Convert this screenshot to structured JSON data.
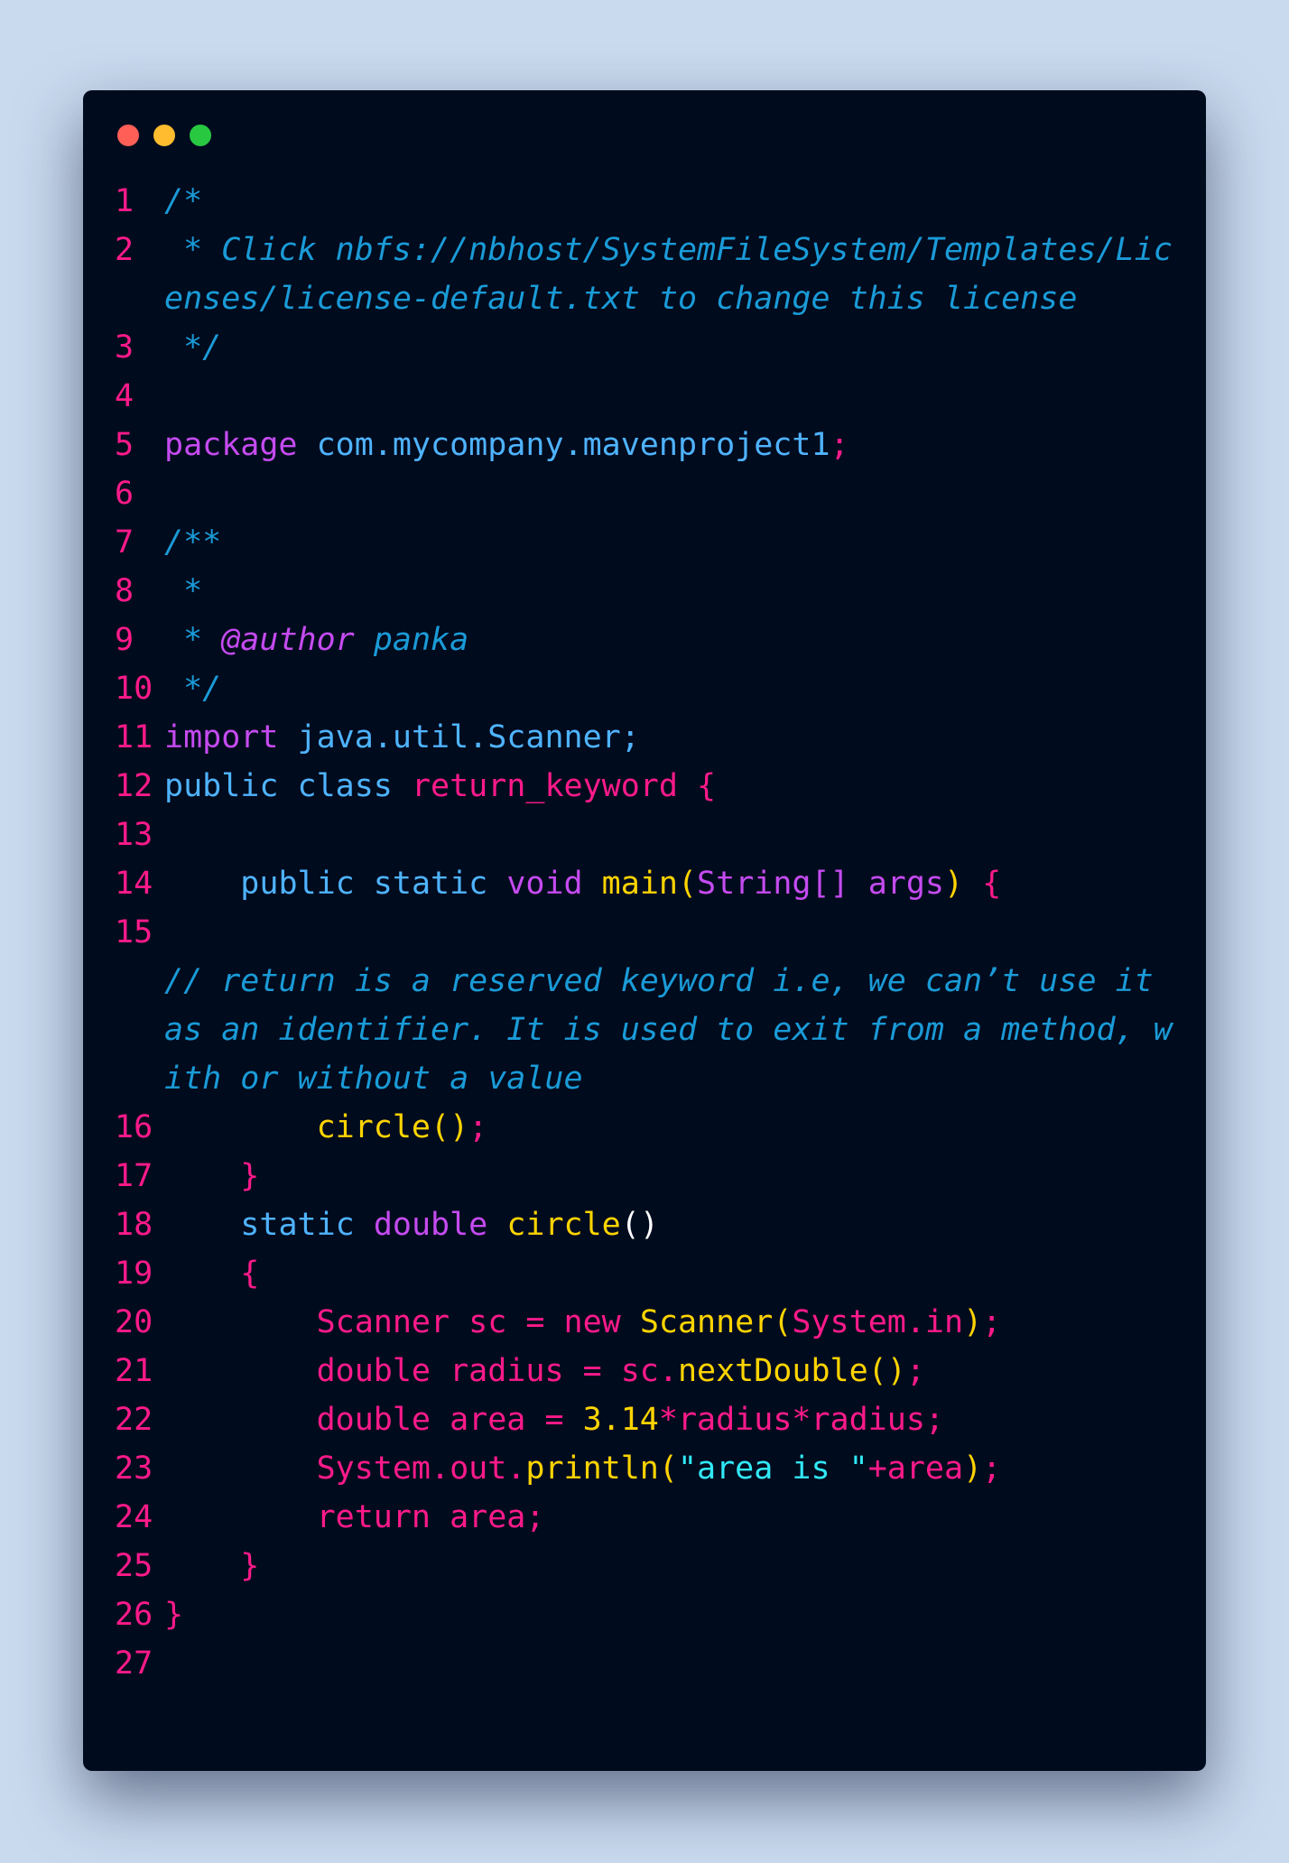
{
  "window": {
    "traffic_lights": [
      {
        "name": "close",
        "color": "#ff5f57"
      },
      {
        "name": "minimize",
        "color": "#febc2e"
      },
      {
        "name": "maximize",
        "color": "#28c840"
      }
    ]
  },
  "colors": {
    "background": "#c9d9ee",
    "editor_background": "#010b1e",
    "line_number": "#ff1a8a",
    "comment": "#1a9bd7",
    "keyword_purple": "#c54bf0",
    "keyword_blue": "#4fb3ff",
    "pink": "#ff1a8a",
    "yellow": "#ffd400",
    "string": "#31e8f5",
    "default": "#2fd0ff"
  },
  "code": [
    {
      "n": "1",
      "tokens": [
        {
          "t": "/*",
          "c": "#1a9bd7",
          "k": "comment"
        }
      ]
    },
    {
      "n": "2",
      "tokens": [
        {
          "t": " * Click nbfs://nbhost/SystemFileSystem/Templates/Licenses/license-default.txt to change this license",
          "c": "#1a9bd7",
          "k": "comment"
        }
      ]
    },
    {
      "n": "3",
      "tokens": [
        {
          "t": " */",
          "c": "#1a9bd7",
          "k": "comment"
        }
      ]
    },
    {
      "n": "4",
      "tokens": []
    },
    {
      "n": "5",
      "tokens": [
        {
          "t": "package",
          "c": "#c54bf0"
        },
        {
          "t": " com.mycompany.mavenproject1",
          "c": "#4fb3ff"
        },
        {
          "t": ";",
          "c": "#ff1a8a"
        }
      ]
    },
    {
      "n": "6",
      "tokens": []
    },
    {
      "n": "7",
      "tokens": [
        {
          "t": "/**",
          "c": "#1a9bd7",
          "k": "comment"
        }
      ]
    },
    {
      "n": "8",
      "tokens": [
        {
          "t": " *",
          "c": "#1a9bd7",
          "k": "comment"
        }
      ]
    },
    {
      "n": "9",
      "tokens": [
        {
          "t": " * ",
          "c": "#1a9bd7",
          "k": "comment"
        },
        {
          "t": "@author",
          "c": "#c54bf0",
          "k": "comment"
        },
        {
          "t": " panka",
          "c": "#1a9bd7",
          "k": "comment"
        }
      ]
    },
    {
      "n": "10",
      "tokens": [
        {
          "t": " */",
          "c": "#1a9bd7",
          "k": "comment"
        }
      ]
    },
    {
      "n": "11",
      "tokens": [
        {
          "t": "import",
          "c": "#c54bf0"
        },
        {
          "t": " java.util.Scanner;",
          "c": "#4fb3ff"
        }
      ]
    },
    {
      "n": "12",
      "tokens": [
        {
          "t": "public class",
          "c": "#4fb3ff"
        },
        {
          "t": " return_keyword {",
          "c": "#ff1a8a"
        }
      ]
    },
    {
      "n": "13",
      "tokens": []
    },
    {
      "n": "14",
      "tokens": [
        {
          "t": "    public static ",
          "c": "#4fb3ff"
        },
        {
          "t": "void ",
          "c": "#c54bf0"
        },
        {
          "t": "main",
          "c": "#ffd400"
        },
        {
          "t": "(",
          "c": "#ffd400"
        },
        {
          "t": "String[] args",
          "c": "#c54bf0"
        },
        {
          "t": ")",
          "c": "#ffd400"
        },
        {
          "t": " {",
          "c": "#ff1a8a"
        }
      ]
    },
    {
      "n": "15",
      "tokens": [
        {
          "t": "\n// return is a reserved keyword i.e, we can’t use it as an identifier. It is used to exit from a method, with or without a value",
          "c": "#1a9bd7",
          "k": "comment"
        }
      ]
    },
    {
      "n": "16",
      "tokens": [
        {
          "t": "        circle",
          "c": "#ffd400"
        },
        {
          "t": "()",
          "c": "#ffd400"
        },
        {
          "t": ";",
          "c": "#ff1a8a"
        }
      ]
    },
    {
      "n": "17",
      "tokens": [
        {
          "t": "    }",
          "c": "#ff1a8a"
        }
      ]
    },
    {
      "n": "18",
      "tokens": [
        {
          "t": "    static ",
          "c": "#4fb3ff"
        },
        {
          "t": "double ",
          "c": "#c54bf0"
        },
        {
          "t": "circle",
          "c": "#ffd400"
        },
        {
          "t": "()",
          "c": "#ffffff"
        }
      ]
    },
    {
      "n": "19",
      "tokens": [
        {
          "t": "    {",
          "c": "#ff1a8a"
        }
      ]
    },
    {
      "n": "20",
      "tokens": [
        {
          "t": "        Scanner sc = ",
          "c": "#ff1a8a"
        },
        {
          "t": "new ",
          "c": "#ff1a8a"
        },
        {
          "t": "Scanner",
          "c": "#ffd400"
        },
        {
          "t": "(",
          "c": "#ffd400"
        },
        {
          "t": "System.in",
          "c": "#ff1a8a"
        },
        {
          "t": ")",
          "c": "#ffd400"
        },
        {
          "t": ";",
          "c": "#ff1a8a"
        }
      ]
    },
    {
      "n": "21",
      "tokens": [
        {
          "t": "        double radius = sc.",
          "c": "#ff1a8a"
        },
        {
          "t": "nextDouble",
          "c": "#ffd400"
        },
        {
          "t": "()",
          "c": "#ffd400"
        },
        {
          "t": ";",
          "c": "#ff1a8a"
        }
      ]
    },
    {
      "n": "22",
      "tokens": [
        {
          "t": "        double area = ",
          "c": "#ff1a8a"
        },
        {
          "t": "3.14",
          "c": "#ffd400"
        },
        {
          "t": "*radius*radius;",
          "c": "#ff1a8a"
        }
      ]
    },
    {
      "n": "23",
      "tokens": [
        {
          "t": "        System.out.",
          "c": "#ff1a8a"
        },
        {
          "t": "println",
          "c": "#ffd400"
        },
        {
          "t": "(",
          "c": "#ffd400"
        },
        {
          "t": "\"area is \"",
          "c": "#31e8f5"
        },
        {
          "t": "+area",
          "c": "#ff1a8a"
        },
        {
          "t": ")",
          "c": "#ffd400"
        },
        {
          "t": ";",
          "c": "#ff1a8a"
        }
      ]
    },
    {
      "n": "24",
      "tokens": [
        {
          "t": "        return area;",
          "c": "#ff1a8a"
        }
      ]
    },
    {
      "n": "25",
      "tokens": [
        {
          "t": "    }",
          "c": "#ff1a8a"
        }
      ]
    },
    {
      "n": "26",
      "tokens": [
        {
          "t": "}",
          "c": "#ff1a8a"
        }
      ]
    },
    {
      "n": "27",
      "tokens": []
    }
  ]
}
